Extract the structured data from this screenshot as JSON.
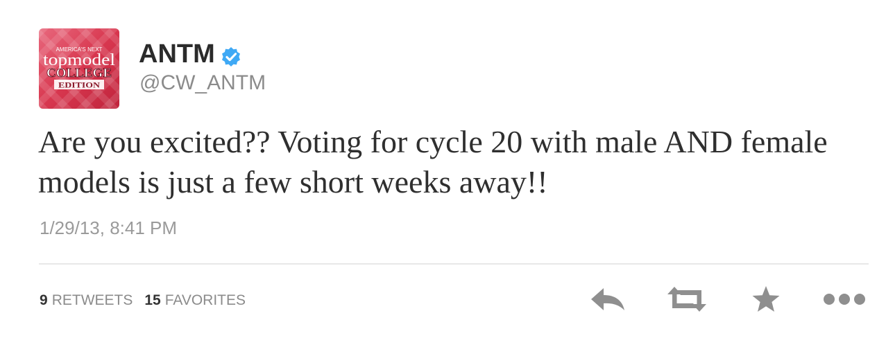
{
  "tweet": {
    "avatar_text": {
      "brand_top": "AMERICA'S NEXT",
      "brand_main": "topmodel",
      "line1": "COLLEGE",
      "line2": "EDITION"
    },
    "display_name": "ANTM",
    "handle": "@CW_ANTM",
    "verified": true,
    "text": "Are you excited?? Voting for cycle 20 with male AND female models is just a few short weeks away!!",
    "timestamp": "1/29/13, 8:41 PM"
  },
  "stats": {
    "retweets_count": "9",
    "retweets_label": "RETWEETS",
    "favorites_count": "15",
    "favorites_label": "FAVORITES"
  },
  "actions": [
    {
      "name": "reply",
      "icon": "reply-icon"
    },
    {
      "name": "retweet",
      "icon": "retweet-icon"
    },
    {
      "name": "favorite",
      "icon": "star-icon"
    },
    {
      "name": "more",
      "icon": "more-dots-icon"
    }
  ],
  "colors": {
    "verified_badge": "#3fa9f5",
    "avatar_background": "#d8374f",
    "icon_gray": "#8f8f8f"
  }
}
